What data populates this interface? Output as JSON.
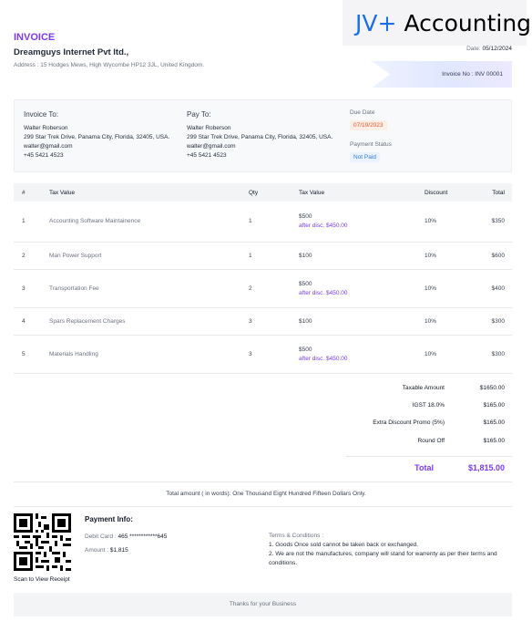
{
  "brand": {
    "prefix": "JV+",
    "name": "Accounting"
  },
  "invoice": {
    "title": "INVOICE",
    "company": "Dreamguys Internet Pvt ltd.,",
    "address": "Address : 15 Hodges Mews, High Wycombe HP12 3JL, United Kingdom.",
    "date_label": "Date:",
    "date_value": "05/12/2024",
    "number_label": "Invoice No :",
    "number_value": "INV 00001"
  },
  "invoice_to": {
    "heading": "Invoice To:",
    "name": "Walter Roberson",
    "address": "299 Star Trek Drive, Panama City, Florida, 32405, USA.",
    "email": "walter@gmail.com",
    "phone": "+45 5421 4523"
  },
  "pay_to": {
    "heading": "Pay To:",
    "name": "Walter Roberson",
    "address": "299 Star Trek Drive, Panama City, Florida, 32405, USA.",
    "email": "walter@gmail.com",
    "phone": "+45 5421 4523"
  },
  "due": {
    "label": "Due Date",
    "value": "07/19/2023"
  },
  "status": {
    "label": "Payment Status",
    "value": "Not Paid"
  },
  "table": {
    "headers": [
      "#",
      "Tax Value",
      "Qty",
      "Tax Value",
      "Discount",
      "Total"
    ],
    "rows": [
      {
        "no": "1",
        "desc": "Accounting Software Maintainence",
        "qty": "1",
        "tax": "$500",
        "after": "after disc. $450.00",
        "discount": "10%",
        "total": "$350"
      },
      {
        "no": "2",
        "desc": "Man Power Support",
        "qty": "1",
        "tax": "$100",
        "after": "",
        "discount": "10%",
        "total": "$600"
      },
      {
        "no": "3",
        "desc": "Transportation Fee",
        "qty": "2",
        "tax": "$500",
        "after": "after disc. $450.00",
        "discount": "10%",
        "total": "$400"
      },
      {
        "no": "4",
        "desc": "Spars Replacement Charges",
        "qty": "3",
        "tax": "$100",
        "after": "",
        "discount": "10%",
        "total": "$300"
      },
      {
        "no": "5",
        "desc": "Materials Handling",
        "qty": "3",
        "tax": "$500",
        "after": "after disc. $450.00",
        "discount": "10%",
        "total": "$300"
      }
    ]
  },
  "totals": [
    {
      "label": "Taxable Amount",
      "value": "$1650.00"
    },
    {
      "label": "IGST 18.0%",
      "value": "$165.00"
    },
    {
      "label": "Extra Discount Promo (5%)",
      "value": "$165.00"
    },
    {
      "label": "Round Off",
      "value": "$165.00"
    }
  ],
  "grand": {
    "label": "Total",
    "value": "$1,815.00"
  },
  "words": "Total amount ( in words):  One Thousand Eight Hundred Fifteen Dollars Only.",
  "payment": {
    "title": "Payment Info:",
    "card_label": "Debit Card :",
    "card_value": "465 ************645",
    "amount_label": "Amount :",
    "amount_value": "$1,815"
  },
  "scan_label": "Scan to View Receipt",
  "terms": {
    "title": "Terms & Conditions :",
    "lines": [
      "1. Goods Once sold cannot be taken back or exchanged.",
      "2. We are not the manufactures, company will stand for warrenty as per their terms and conditions."
    ]
  },
  "footer": "Thanks for your Business"
}
